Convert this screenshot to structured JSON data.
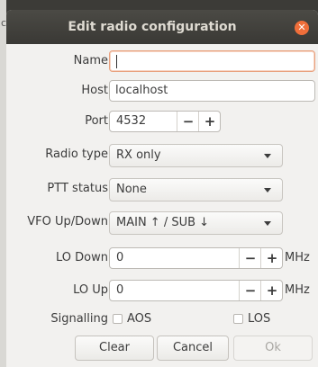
{
  "dialog": {
    "title": "Edit radio configuration",
    "close_icon": "close-icon"
  },
  "form": {
    "name": {
      "label": "Name",
      "value": ""
    },
    "host": {
      "label": "Host",
      "value": "localhost"
    },
    "port": {
      "label": "Port",
      "value": "4532",
      "minus": "−",
      "plus": "+"
    },
    "radio_type": {
      "label": "Radio type",
      "value": "RX only"
    },
    "ptt_status": {
      "label": "PTT status",
      "value": "None"
    },
    "vfo": {
      "label": "VFO Up/Down",
      "value": "MAIN ↑ / SUB ↓"
    },
    "lo_down": {
      "label": "LO Down",
      "value": "0",
      "minus": "−",
      "plus": "+",
      "unit": "MHz"
    },
    "lo_up": {
      "label": "LO Up",
      "value": "0",
      "minus": "−",
      "plus": "+",
      "unit": "MHz"
    },
    "signalling": {
      "label": "Signalling",
      "aos": "AOS",
      "los": "LOS"
    }
  },
  "buttons": {
    "clear": "Clear",
    "cancel": "Cancel",
    "ok": "Ok"
  }
}
